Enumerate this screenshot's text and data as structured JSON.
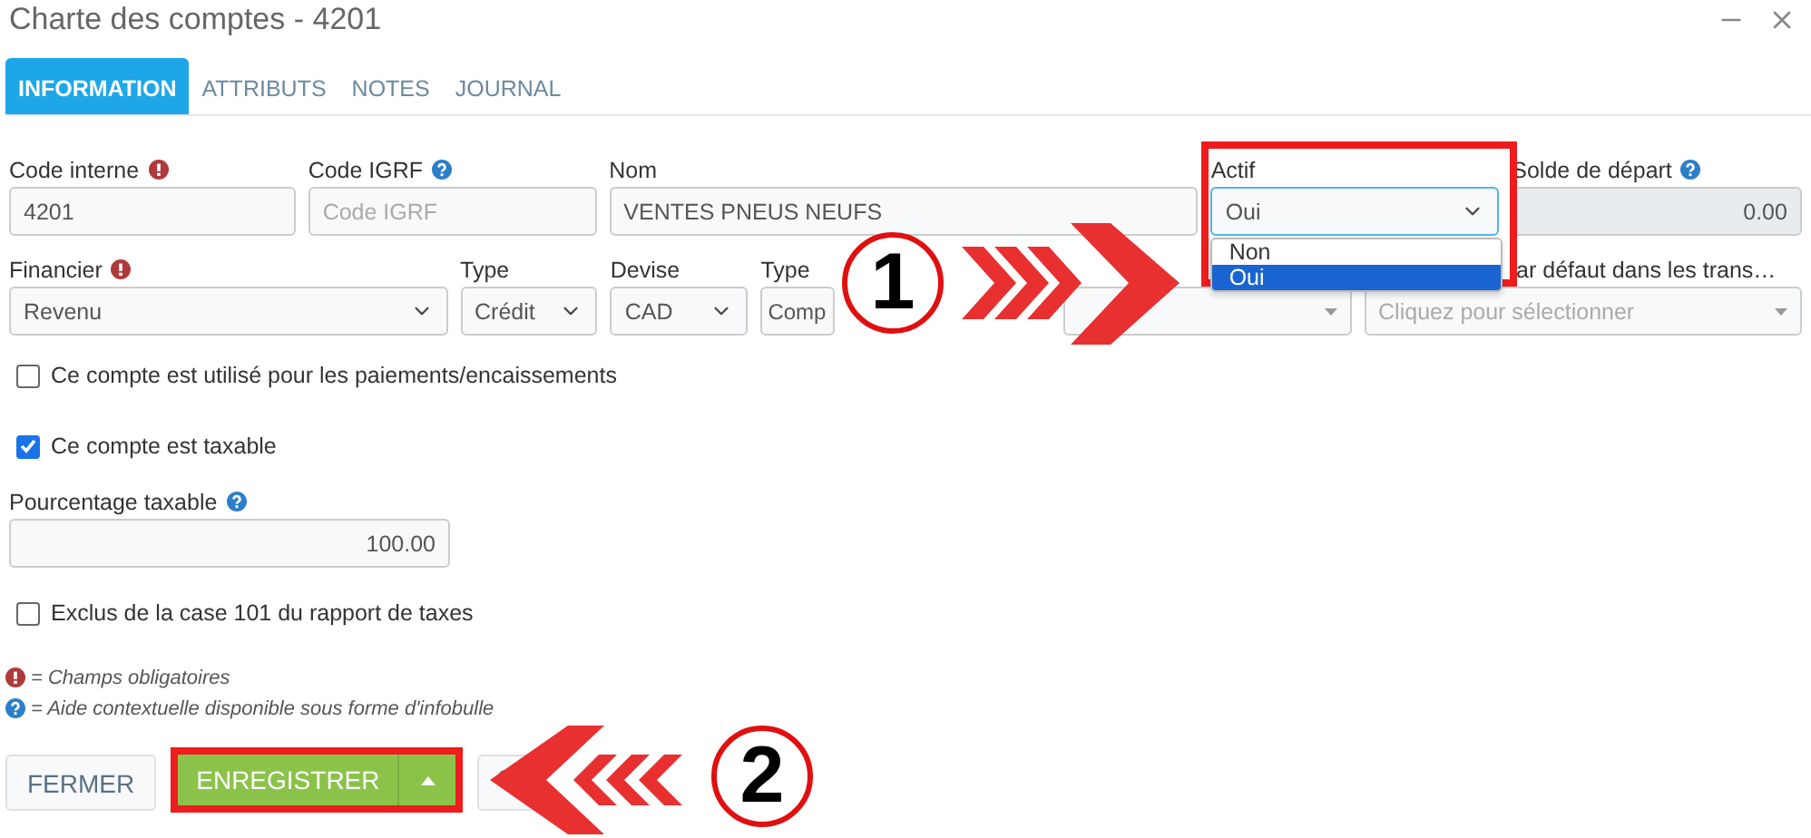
{
  "window": {
    "title": "Charte des comptes - 4201"
  },
  "tabs": [
    {
      "label": "INFORMATION",
      "selected": true
    },
    {
      "label": "ATTRIBUTS",
      "selected": false
    },
    {
      "label": "NOTES",
      "selected": false
    },
    {
      "label": "JOURNAL",
      "selected": false
    }
  ],
  "row_1": [
    {
      "label": "Code interne",
      "required": true,
      "kind": "input",
      "value": "4201"
    },
    {
      "label": "Code IGRF",
      "help": true,
      "kind": "input",
      "placeholder": "Code IGRF"
    },
    {
      "label": "Nom",
      "kind": "input",
      "value": "VENTES PNEUS NEUFS"
    },
    {
      "label": "Actif",
      "kind": "select",
      "value": "Oui",
      "focused": true,
      "options": [
        {
          "label": "Non",
          "selected": false
        },
        {
          "label": "Oui",
          "selected": true
        }
      ]
    },
    {
      "label": "Solde de départ",
      "help": true,
      "kind": "number",
      "value": "0.00",
      "disabled": true
    }
  ],
  "row_2": [
    {
      "label": "Financier",
      "required": true,
      "kind": "select",
      "value": "Revenu"
    },
    {
      "label": "Type",
      "kind": "select",
      "value": "Crédit"
    },
    {
      "label": "Devise",
      "kind": "select",
      "value": "CAD"
    },
    {
      "label": "Type",
      "kind": "select",
      "value": "Comp"
    },
    {
      "kind": "multi"
    },
    {
      "label": "ar défaut dans les trans…",
      "kind": "multi",
      "placeholder": "Cliquez pour sélectionner"
    }
  ],
  "options": [
    {
      "label": "Ce compte est utilisé pour les paiements/encaissements",
      "checked": false
    },
    {
      "label": "Ce compte est taxable",
      "checked": true
    }
  ],
  "percent": {
    "label": "Pourcentage taxable",
    "help": true,
    "kind": "number",
    "value": "100.00"
  },
  "exclusion": {
    "label": "Exclus de la case 101 du rapport de taxes",
    "checked": false
  },
  "legend": [
    {
      "kind": "required",
      "text": "= Champs obligatoires"
    },
    {
      "kind": "help",
      "text": "= Aide contextuelle disponible sous forme d'infobulle"
    }
  ],
  "buttons": {
    "close": "FERMER",
    "save": "ENREGISTRER"
  },
  "annotations": [
    {
      "kind": "marker",
      "label": "1"
    },
    {
      "kind": "marker",
      "label": "2"
    }
  ]
}
